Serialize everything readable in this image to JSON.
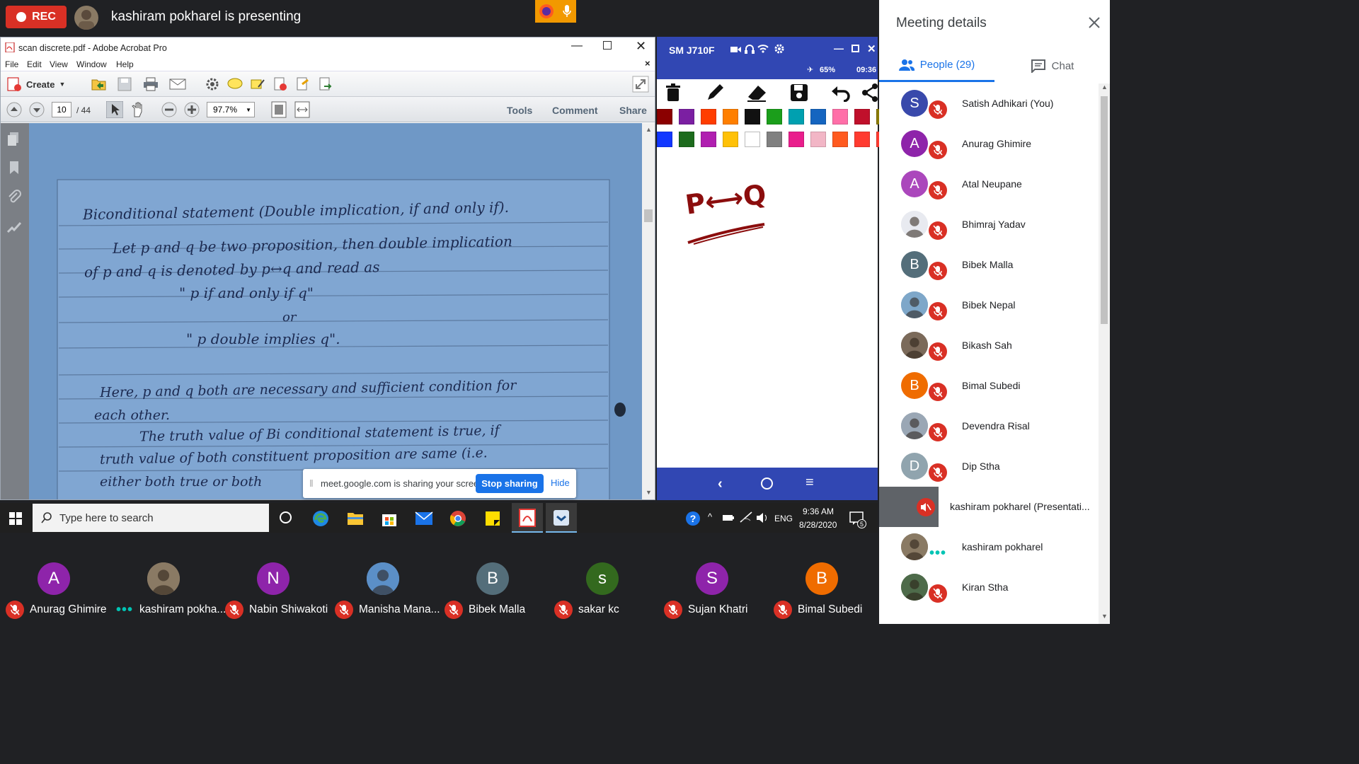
{
  "topbar": {
    "rec_label": "REC",
    "presenting_text": "kashiram pokharel is presenting"
  },
  "acrobat": {
    "window_title": "scan discrete.pdf - Adobe Acrobat Pro",
    "menu": [
      "File",
      "Edit",
      "View",
      "Window",
      "Help"
    ],
    "create_label": "Create",
    "page_current": "10",
    "page_total": "/ 44",
    "zoom": "97.7%",
    "tools_label": "Tools",
    "comment_label": "Comment",
    "share_label": "Share",
    "page_lines": [
      "Biconditional statement (Double implication, if and only if).",
      "Let p and q be two proposition, then double implication",
      "of p and q is denoted by p↔q and read as",
      "\" p if and only if q\"",
      "or",
      "\" p double implies q\".",
      "Here, p and q both are necessary and sufficient condition for",
      "each other.",
      "The truth value of Bi conditional statement is true, if",
      "truth value of both constituent proposition are same (i.e.",
      "either both true or both"
    ]
  },
  "phone": {
    "device_name": "SM J710F",
    "battery": "65%",
    "clock": "09:36",
    "whiteboard_text": "P⟷Q",
    "palette_row1": [
      "#8b0000",
      "#7b1fa2",
      "#ff3d00",
      "#ff7f00",
      "#111111",
      "#1b9e1b",
      "#00a0b0",
      "#1565c0",
      "#ff6fa8",
      "#c0102b",
      "#8a7a00"
    ],
    "palette_row2": [
      "#1237ff",
      "#1d6b1d",
      "#b01fb0",
      "#ffc107",
      "#ffffff",
      "#808080",
      "#e91e8c",
      "#f2b6c6",
      "#ff5a1f",
      "#ff3b30",
      "#ff3b30"
    ]
  },
  "share_banner": {
    "text": "meet.google.com is sharing your screen.",
    "stop_label": "Stop sharing",
    "hide_label": "Hide"
  },
  "taskbar": {
    "search_placeholder": "Type here to search",
    "lang": "ENG",
    "time": "9:36 AM",
    "date": "8/28/2020",
    "notif_count": "5"
  },
  "tiles": [
    {
      "initial": "A",
      "name": "Anurag Ghimire",
      "color": "#8e24aa",
      "status": "muted"
    },
    {
      "initial": "",
      "name": "kashiram pokha...",
      "color": "#8a7a64",
      "status": "speaking"
    },
    {
      "initial": "N",
      "name": "Nabin Shiwakoti",
      "color": "#8e24aa",
      "status": "muted"
    },
    {
      "initial": "",
      "name": "Manisha Mana...",
      "color": "#5b8fc7",
      "status": "muted"
    },
    {
      "initial": "B",
      "name": "Bibek Malla",
      "color": "#546e7a",
      "status": "muted"
    },
    {
      "initial": "s",
      "name": "sakar kc",
      "color": "#33691e",
      "status": "muted"
    },
    {
      "initial": "S",
      "name": "Sujan Khatri",
      "color": "#8e24aa",
      "status": "muted"
    },
    {
      "initial": "B",
      "name": "Bimal Subedi",
      "color": "#ef6c00",
      "status": "muted"
    }
  ],
  "panel": {
    "title": "Meeting details",
    "tab_people": "People (29)",
    "tab_chat": "Chat",
    "people": [
      {
        "initial": "S",
        "name": "Satish Adhikari (You)",
        "color": "#3949ab",
        "status": "muted"
      },
      {
        "initial": "A",
        "name": "Anurag Ghimire",
        "color": "#8e24aa",
        "status": "muted"
      },
      {
        "initial": "A",
        "name": "Atal Neupane",
        "color": "#ab47bc",
        "status": "muted"
      },
      {
        "initial": "",
        "name": "Bhimraj Yadav",
        "color": "#e8eaf0",
        "status": "muted"
      },
      {
        "initial": "B",
        "name": "Bibek Malla",
        "color": "#546e7a",
        "status": "muted"
      },
      {
        "initial": "",
        "name": "Bibek Nepal",
        "color": "#7ea7c9",
        "status": "muted"
      },
      {
        "initial": "",
        "name": "Bikash Sah",
        "color": "#7b6a5a",
        "status": "muted"
      },
      {
        "initial": "B",
        "name": "Bimal Subedi",
        "color": "#ef6c00",
        "status": "muted"
      },
      {
        "initial": "",
        "name": "Devendra Risal",
        "color": "#9aa7b5",
        "status": "muted"
      },
      {
        "initial": "D",
        "name": "Dip Stha",
        "color": "#90a4ae",
        "status": "muted"
      },
      {
        "initial": "",
        "name": "kashiram pokharel (Presentati...",
        "color": "#5f6368",
        "status": "presenting"
      },
      {
        "initial": "",
        "name": "kashiram pokharel",
        "color": "#8a7a64",
        "status": "speaking"
      },
      {
        "initial": "",
        "name": "Kiran Stha",
        "color": "#4e6b4a",
        "status": "muted"
      }
    ]
  }
}
